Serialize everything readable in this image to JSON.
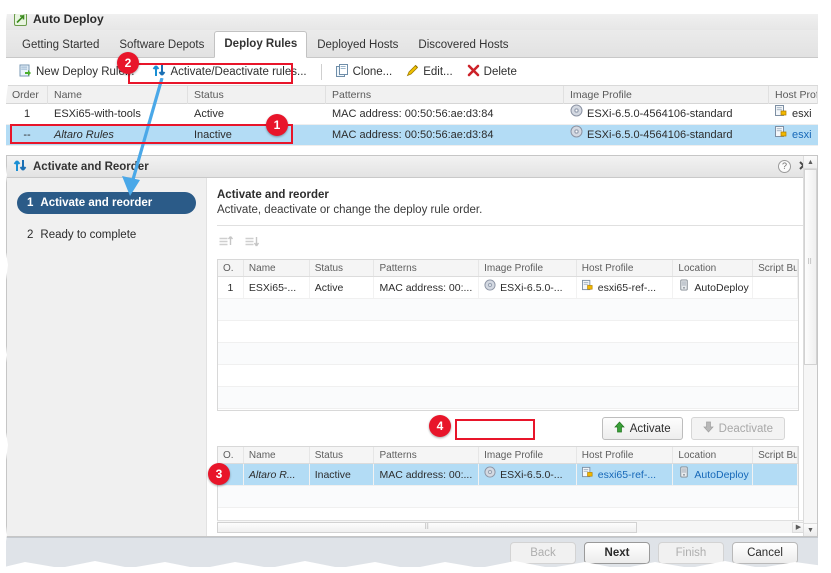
{
  "window": {
    "title": "Auto Deploy",
    "icon": "auto-deploy-icon"
  },
  "tabs": [
    {
      "label": "Getting Started",
      "selected": false
    },
    {
      "label": "Software Depots",
      "selected": false
    },
    {
      "label": "Deploy Rules",
      "selected": true
    },
    {
      "label": "Deployed Hosts",
      "selected": false
    },
    {
      "label": "Discovered Hosts",
      "selected": false
    }
  ],
  "toolbar": {
    "new_rule": "New Deploy Rule...",
    "activate_rules": "Activate/Deactivate rules...",
    "clone": "Clone...",
    "edit": "Edit...",
    "delete": "Delete"
  },
  "main_grid": {
    "columns": [
      "Order",
      "Name",
      "Status",
      "Patterns",
      "Image Profile",
      "Host Profile"
    ],
    "rows": [
      {
        "order": "1",
        "name": "ESXi65-with-tools",
        "status": "Active",
        "patterns": "MAC address: 00:50:56:ae:d3:84",
        "image_profile": "ESXi-6.5.0-4564106-standard",
        "host_profile": "esxi",
        "selected": false,
        "italic": false
      },
      {
        "order": "--",
        "name": "Altaro Rules",
        "status": "Inactive",
        "patterns": "MAC address: 00:50:56:ae:d3:84",
        "image_profile": "ESXi-6.5.0-4564106-standard",
        "host_profile": "esxi",
        "selected": true,
        "italic": true
      }
    ]
  },
  "wizard": {
    "title": "Activate and Reorder",
    "help_icon": "question-mark-icon",
    "expand_icon": "double-chevron-right-icon",
    "steps": [
      {
        "number": "1",
        "label": "Activate and reorder",
        "active": true
      },
      {
        "number": "2",
        "label": "Ready to complete",
        "active": false
      }
    ],
    "content_title": "Activate and reorder",
    "content_subtitle": "Activate, deactivate or change the deploy rule order.",
    "move_up_icon": "move-up-icon",
    "move_down_icon": "move-down-icon",
    "active_table": {
      "columns": [
        "O.",
        "Name",
        "Status",
        "Patterns",
        "Image Profile",
        "Host Profile",
        "Location",
        "Script Bu"
      ],
      "rows": [
        {
          "order": "1",
          "name": "ESXi65-...",
          "status": "Active",
          "patterns": "MAC address: 00:...",
          "image_profile": "ESXi-6.5.0-...",
          "host_profile": "esxi65-ref-...",
          "location": "AutoDeploy",
          "script_bundle": "",
          "selected": false,
          "italic": false
        }
      ]
    },
    "buttons": {
      "activate": "Activate",
      "activate_icon": "arrow-up-green-icon",
      "deactivate": "Deactivate",
      "deactivate_icon": "arrow-down-grey-icon",
      "deactivate_disabled": true
    },
    "inactive_table": {
      "columns": [
        "O.",
        "Name",
        "Status",
        "Patterns",
        "Image Profile",
        "Host Profile",
        "Location",
        "Script Bu"
      ],
      "rows": [
        {
          "order": "",
          "name": "Altaro R...",
          "status": "Inactive",
          "patterns": "MAC address: 00:...",
          "image_profile": "ESXi-6.5.0-...",
          "host_profile": "esxi65-ref-...",
          "location": "AutoDeploy",
          "script_bundle": "",
          "selected": true,
          "italic": true
        }
      ]
    }
  },
  "footer": {
    "back": "Back",
    "next": "Next",
    "finish": "Finish",
    "cancel": "Cancel",
    "back_disabled": true,
    "next_disabled": false,
    "finish_disabled": true,
    "cancel_disabled": false
  },
  "annotations": [
    {
      "number": "1"
    },
    {
      "number": "2"
    },
    {
      "number": "3"
    },
    {
      "number": "4"
    }
  ],
  "colors": {
    "annotation_red": "#e8152a",
    "selection_blue": "#b3dcf5",
    "link_blue": "#1668b8",
    "step_active": "#2b5b88",
    "activate_green": "#3aa03a"
  }
}
